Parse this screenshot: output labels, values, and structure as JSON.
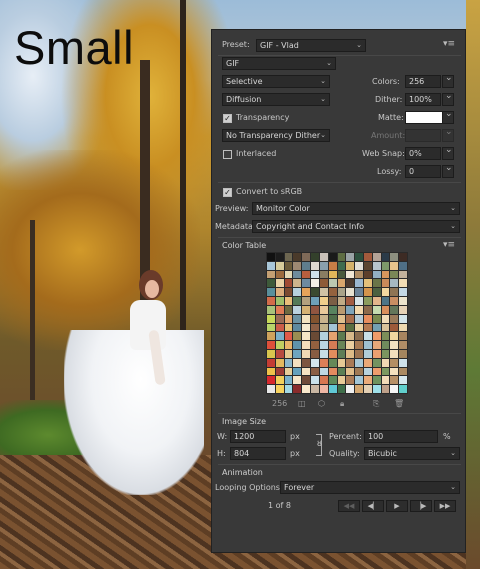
{
  "overlay_label": "Small",
  "panel": {
    "preset_label": "Preset:",
    "preset_value": "GIF - Vlad",
    "format_value": "GIF",
    "reduction_value": "Selective",
    "dither_algo_value": "Diffusion",
    "transparency_label": "Transparency",
    "transparency_checked": true,
    "transparency_dither_value": "No Transparency Dither",
    "interlaced_label": "Interlaced",
    "interlaced_checked": false,
    "colors_label": "Colors:",
    "colors_value": "256",
    "dither_label": "Dither:",
    "dither_value": "100%",
    "matte_label": "Matte:",
    "amount_label": "Amount:",
    "websnap_label": "Web Snap:",
    "websnap_value": "0%",
    "lossy_label": "Lossy:",
    "lossy_value": "0",
    "convert_label": "Convert to sRGB",
    "convert_checked": true,
    "preview_label": "Preview:",
    "preview_value": "Monitor Color",
    "metadata_label": "Metadata:",
    "metadata_value": "Copyright and Contact Info",
    "color_table_title": "Color Table",
    "color_count": "256",
    "image_size_title": "Image Size",
    "w_label": "W:",
    "w_value": "1200",
    "h_label": "H:",
    "h_value": "804",
    "px_unit": "px",
    "percent_label": "Percent:",
    "percent_value": "100",
    "percent_unit": "%",
    "quality_label": "Quality:",
    "quality_value": "Bicubic",
    "animation_title": "Animation",
    "looping_label": "Looping Options:",
    "looping_value": "Forever",
    "frame_counter": "1 of 8"
  },
  "palette": [
    "#111111",
    "#1d1d1d",
    "#6d6650",
    "#4a3a2a",
    "#7f6a58",
    "#33402b",
    "#c9c1b9",
    "#1a1a1a",
    "#5e6d43",
    "#9aa3a6",
    "#2d4f3d",
    "#a35a3c",
    "#b4a397",
    "#2a3a48",
    "#8d8f7f",
    "#3d2b24",
    "#a9c7d9",
    "#d7cc9c",
    "#6b5b3a",
    "#9d8872",
    "#5f7d8d",
    "#ded8cf",
    "#8aa0ae",
    "#c77d46",
    "#3f6b4e",
    "#d4b26a",
    "#e2e0d8",
    "#5c4631",
    "#b8c5cc",
    "#7d9a6a",
    "#e8c58d",
    "#4f6f86",
    "#c5a073",
    "#9c6b3f",
    "#e4d9b5",
    "#6f8c9d",
    "#b85e3e",
    "#cfe0ea",
    "#8a7e62",
    "#e1b75a",
    "#4a5a3c",
    "#f0e7d5",
    "#ae8c64",
    "#5d3f2b",
    "#94b0c2",
    "#d9955d",
    "#7a8857",
    "#c3b29b",
    "#3e5a3a",
    "#e9d2a6",
    "#a04a33",
    "#cdb48c",
    "#6e8aa0",
    "#f4efe6",
    "#8e5b38",
    "#bcc9b0",
    "#d8a66c",
    "#4c3a2e",
    "#9bb7cf",
    "#e3c07a",
    "#6a7548",
    "#c98a5a",
    "#a7b8c0",
    "#f1dcb4",
    "#5a8f9c",
    "#dcae7d",
    "#7c4b30",
    "#b7d0dd",
    "#e6a35a",
    "#3b4a30",
    "#cfc2a5",
    "#94623e",
    "#a9a389",
    "#e7e1cf",
    "#6b8296",
    "#d3944c",
    "#4b6040",
    "#f2d8a0",
    "#8f7454",
    "#c4d8e4",
    "#d26b4a",
    "#9fbf6b",
    "#e8bf7a",
    "#547a58",
    "#b3a07e",
    "#6fa0b8",
    "#f0cf8c",
    "#7b5e45",
    "#c1ab86",
    "#a35c42",
    "#d9e3e6",
    "#8b9c5e",
    "#e2b58b",
    "#4e7486",
    "#c98e63",
    "#ede4cc",
    "#a8c27a",
    "#e07c56",
    "#6f6a40",
    "#bcd3df",
    "#d6b274",
    "#925540",
    "#e9c99b",
    "#58835f",
    "#b99a70",
    "#7fa4b9",
    "#f3d9ad",
    "#8c6a4c",
    "#c6dbb0",
    "#d98f5c",
    "#64765a",
    "#e6d2b6",
    "#c7d95a",
    "#9b6b55",
    "#e4a86f",
    "#6d93a3",
    "#f2e2c0",
    "#83532f",
    "#c9b48e",
    "#4f6d4a",
    "#dfc08e",
    "#a86e4c",
    "#b6cbd6",
    "#e78e5f",
    "#7a8a50",
    "#f0ddb8",
    "#9a7a5a",
    "#d3e4ea",
    "#b8d46a",
    "#cc5d48",
    "#e7c275",
    "#5f8aa0",
    "#f4e9cf",
    "#8d5e44",
    "#c2b38a",
    "#a3c4d6",
    "#dd9b64",
    "#5a6e40",
    "#ebd4a5",
    "#b47a52",
    "#74a0b2",
    "#d9c49b",
    "#9e5a3a",
    "#eed9b0",
    "#cfa35c",
    "#7ab0c9",
    "#e15a48",
    "#9a8d52",
    "#f6e6c6",
    "#6a4a35",
    "#b3d0dc",
    "#e3a270",
    "#5c7b4f",
    "#d8b98a",
    "#8b6d4f",
    "#c9e0e8",
    "#ef9b6a",
    "#7b8e58",
    "#f1d6a0",
    "#a8855f",
    "#df4f3a",
    "#c0cf62",
    "#e8b46a",
    "#5f93ab",
    "#f2ddbd",
    "#93603f",
    "#bcd6e2",
    "#d57c55",
    "#688557",
    "#e9ceA0",
    "#a77b55",
    "#9fc0d0",
    "#e6a879",
    "#708a5c",
    "#f4e3c2",
    "#b08d66",
    "#d9c64e",
    "#b64a3f",
    "#e5c991",
    "#6ea5bf",
    "#f0d9b5",
    "#875c42",
    "#c7dde6",
    "#e18d5d",
    "#5e7d56",
    "#ddbb88",
    "#9d7452",
    "#b1cdd9",
    "#ec9f70",
    "#7b955f",
    "#f3dfbc",
    "#a5865e",
    "#c43d34",
    "#e3b95f",
    "#8bb7cc",
    "#f4e0c0",
    "#7d5540",
    "#d3e6ec",
    "#dc7f58",
    "#668858",
    "#e6c995",
    "#a97a56",
    "#a9c8d6",
    "#e9a877",
    "#749360",
    "#f1d9b4",
    "#b38e63",
    "#cfe2ea",
    "#eec24a",
    "#9e3e36",
    "#e8cf9a",
    "#64a0bc",
    "#f5e4c5",
    "#8a5f45",
    "#c0d9e3",
    "#e48b5f",
    "#5b7f55",
    "#e0bf8d",
    "#a07a55",
    "#b8d2dd",
    "#ef9d6d",
    "#7c9960",
    "#f4e1bf",
    "#ab8a62",
    "#d6292e",
    "#f2d05c",
    "#79b2cb",
    "#f6e5c8",
    "#6f4b3a",
    "#c9e1ea",
    "#d77752",
    "#5f8a5a",
    "#e8cb98",
    "#ad7d58",
    "#a3c6d6",
    "#ebab7a",
    "#6f935e",
    "#f2dbb7",
    "#b79067",
    "#d7e8ee",
    "#e8e8e8",
    "#f6d25e",
    "#a2d9e6",
    "#8a2c2c",
    "#f9e9cc",
    "#c8b6a2",
    "#eeb6a4",
    "#60c9d6",
    "#3f6f4a",
    "#f0f0f0",
    "#d4a872",
    "#e4d0b4",
    "#9fe0e9",
    "#bfa18a",
    "#f5f5f5",
    "#61d0cd"
  ]
}
